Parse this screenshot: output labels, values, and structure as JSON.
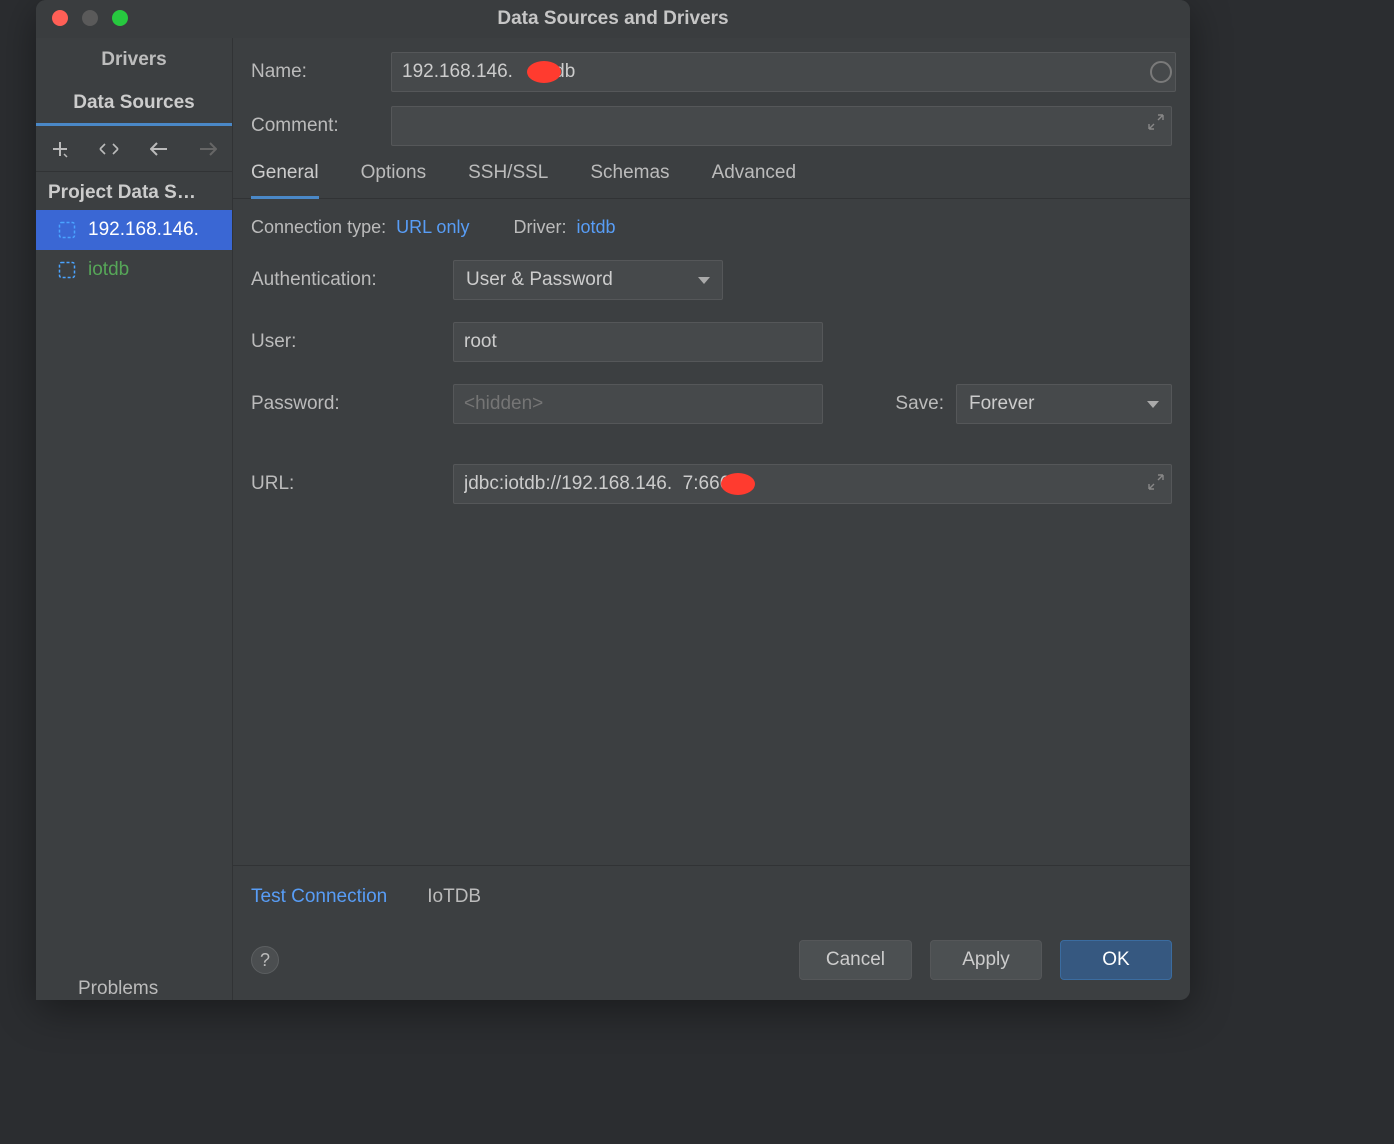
{
  "window": {
    "title": "Data Sources and Drivers"
  },
  "sidebar": {
    "tabs": {
      "drivers": "Drivers",
      "data_sources": "Data Sources"
    },
    "heading": "Project Data S…",
    "items": [
      {
        "label": "192.168.146."
      },
      {
        "label": "iotdb"
      }
    ],
    "problems": "Problems"
  },
  "form": {
    "name_label": "Name:",
    "name_value": "192.168.146.    iotdb",
    "comment_label": "Comment:",
    "comment_value": ""
  },
  "tabs": {
    "general": "General",
    "options": "Options",
    "sshssl": "SSH/SSL",
    "schemas": "Schemas",
    "advanced": "Advanced"
  },
  "general": {
    "conn_type_label": "Connection type:",
    "conn_type_value": "URL only",
    "driver_label": "Driver:",
    "driver_value": "iotdb",
    "auth_label": "Authentication:",
    "auth_value": "User & Password",
    "user_label": "User:",
    "user_value": "root",
    "password_label": "Password:",
    "password_placeholder": "<hidden>",
    "save_label": "Save:",
    "save_value": "Forever",
    "url_label": "URL:",
    "url_value": "jdbc:iotdb://192.168.146.  7:6669/"
  },
  "footer": {
    "test": "Test Connection",
    "driver_name": "IoTDB"
  },
  "buttons": {
    "help": "?",
    "cancel": "Cancel",
    "apply": "Apply",
    "ok": "OK"
  }
}
